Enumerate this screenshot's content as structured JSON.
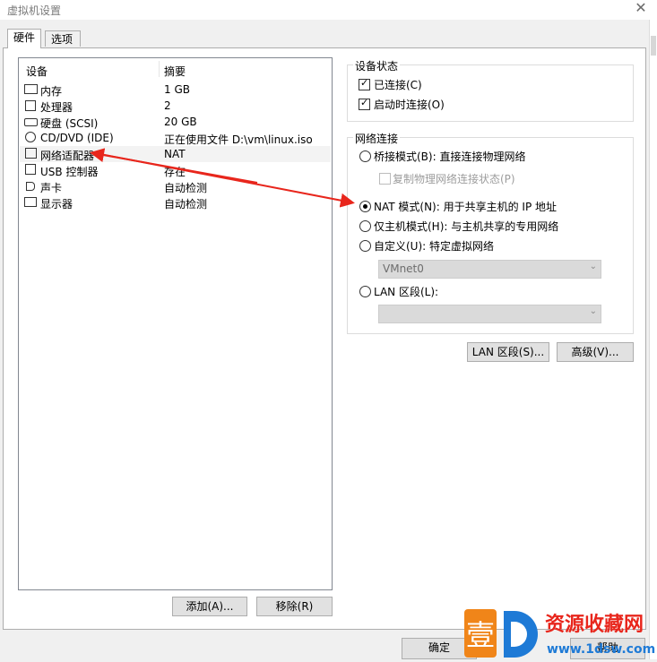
{
  "window": {
    "title": "虚拟机设置",
    "close_glyph": "✕"
  },
  "tabs": [
    {
      "label": "硬件",
      "active": true
    },
    {
      "label": "选项",
      "active": false
    }
  ],
  "hardware_list": {
    "columns": [
      "设备",
      "摘要"
    ],
    "rows": [
      {
        "name": "内存",
        "summary": "1 GB",
        "icon": "memory-icon"
      },
      {
        "name": "处理器",
        "summary": "2",
        "icon": "processor-icon"
      },
      {
        "name": "硬盘 (SCSI)",
        "summary": "20 GB",
        "icon": "hard-disk-icon"
      },
      {
        "name": "CD/DVD (IDE)",
        "summary": "正在使用文件 D:\\vm\\linux.iso",
        "icon": "cd-dvd-icon"
      },
      {
        "name": "网络适配器",
        "summary": "NAT",
        "icon": "network-adapter-icon",
        "selected": true
      },
      {
        "name": "USB 控制器",
        "summary": "存在",
        "icon": "usb-icon"
      },
      {
        "name": "声卡",
        "summary": "自动检测",
        "icon": "sound-card-icon"
      },
      {
        "name": "显示器",
        "summary": "自动检测",
        "icon": "display-icon"
      }
    ]
  },
  "list_buttons": {
    "add": "添加(A)...",
    "remove": "移除(R)"
  },
  "device_status": {
    "title": "设备状态",
    "connected": {
      "label": "已连接(C)",
      "checked": true
    },
    "connect_at_power_on": {
      "label": "启动时连接(O)",
      "checked": true
    }
  },
  "network_connection": {
    "title": "网络连接",
    "bridged": {
      "label": "桥接模式(B): 直接连接物理网络",
      "selected": false
    },
    "replicate": {
      "label": "复制物理网络连接状态(P)",
      "checked": false,
      "disabled": true
    },
    "nat": {
      "label": "NAT 模式(N): 用于共享主机的 IP 地址",
      "selected": true
    },
    "host_only": {
      "label": "仅主机模式(H): 与主机共享的专用网络",
      "selected": false
    },
    "custom": {
      "label": "自定义(U): 特定虚拟网络",
      "selected": false
    },
    "custom_value": "VMnet0",
    "lan_segment": {
      "label": "LAN 区段(L):",
      "selected": false
    },
    "lan_segment_value": ""
  },
  "network_buttons": {
    "lan_segments": "LAN 区段(S)...",
    "advanced": "高级(V)..."
  },
  "footer_buttons": {
    "ok": "确定",
    "help": "帮助"
  },
  "watermark": {
    "logo_char": "壹",
    "brand": "资源收藏网",
    "url": "www.1dsw.com"
  },
  "colors": {
    "annotation_arrow": "#e8261c",
    "selection_bg": "#f3f3f3",
    "watermark_orange": "#f08519",
    "watermark_blue": "#1e7ad6"
  }
}
